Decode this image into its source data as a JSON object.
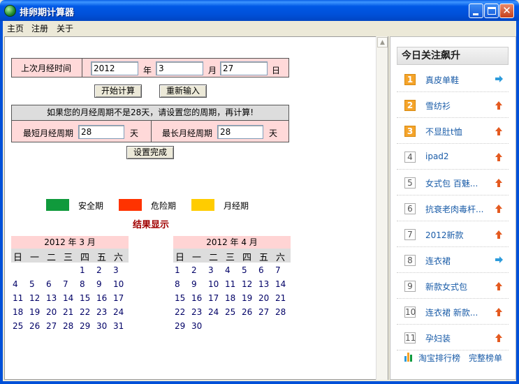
{
  "window": {
    "title": "排卵期计算器"
  },
  "menu": [
    "主页",
    "注册",
    "关于"
  ],
  "form": {
    "last_period_label": "上次月经时间",
    "year_value": "2012",
    "year_unit": "年",
    "month_value": "3",
    "month_unit": "月",
    "day_value": "27",
    "day_unit": "日",
    "calc_button": "开始计算",
    "reset_button": "重新输入",
    "notice": "如果您的月经周期不是28天，请设置您的周期，再计算!",
    "min_cycle_label": "最短月经周期",
    "min_cycle_value": "28",
    "min_cycle_unit": "天",
    "max_cycle_label": "最长月经周期",
    "max_cycle_value": "28",
    "max_cycle_unit": "天",
    "done_button": "设置完成"
  },
  "legend": [
    {
      "label": "安全期",
      "color": "#109a3c"
    },
    {
      "label": "危险期",
      "color": "#ff3300"
    },
    {
      "label": "月经期",
      "color": "#ffcc00"
    }
  ],
  "result_title": "结果显示",
  "calendars": [
    {
      "header": "2012 年 3 月",
      "weekdays": [
        "日",
        "一",
        "二",
        "三",
        "四",
        "五",
        "六"
      ],
      "rows": [
        [
          "",
          "",
          "",
          "",
          "1",
          "2",
          "3"
        ],
        [
          "4",
          "5",
          "6",
          "7",
          "8",
          "9",
          "10"
        ],
        [
          "11",
          "12",
          "13",
          "14",
          "15",
          "16",
          "17"
        ],
        [
          "18",
          "19",
          "20",
          "21",
          "22",
          "23",
          "24"
        ],
        [
          "25",
          "26",
          "27",
          "28",
          "29",
          "30",
          "31"
        ]
      ]
    },
    {
      "header": "2012 年 4 月",
      "weekdays": [
        "日",
        "一",
        "二",
        "三",
        "四",
        "五",
        "六"
      ],
      "rows": [
        [
          "1",
          "2",
          "3",
          "4",
          "5",
          "6",
          "7"
        ],
        [
          "8",
          "9",
          "10",
          "11",
          "12",
          "13",
          "14"
        ],
        [
          "15",
          "16",
          "17",
          "18",
          "19",
          "20",
          "21"
        ],
        [
          "22",
          "23",
          "24",
          "25",
          "26",
          "27",
          "28"
        ],
        [
          "29",
          "30",
          "",
          "",
          "",
          "",
          ""
        ]
      ]
    }
  ],
  "right_panel": {
    "title": "今日关注飙升",
    "items": [
      {
        "rank": "1",
        "name": "真皮单鞋",
        "trend": "right"
      },
      {
        "rank": "2",
        "name": "雪纺衫",
        "trend": "up"
      },
      {
        "rank": "3",
        "name": "不显肚t恤",
        "trend": "up"
      },
      {
        "rank": "4",
        "name": "ipad2",
        "trend": "up"
      },
      {
        "rank": "5",
        "name": "女式包 百魅...",
        "trend": "up"
      },
      {
        "rank": "6",
        "name": "抗衰老肉毒杆...",
        "trend": "up"
      },
      {
        "rank": "7",
        "name": "2012新款",
        "trend": "up"
      },
      {
        "rank": "8",
        "name": "连衣裙",
        "trend": "right"
      },
      {
        "rank": "9",
        "name": "新款女式包",
        "trend": "up"
      },
      {
        "rank": "10",
        "name": "连衣裙 新款...",
        "trend": "up"
      },
      {
        "rank": "11",
        "name": "孕妇装",
        "trend": "up"
      }
    ],
    "footer_link": "淘宝排行榜",
    "footer_full": "完整榜单"
  }
}
